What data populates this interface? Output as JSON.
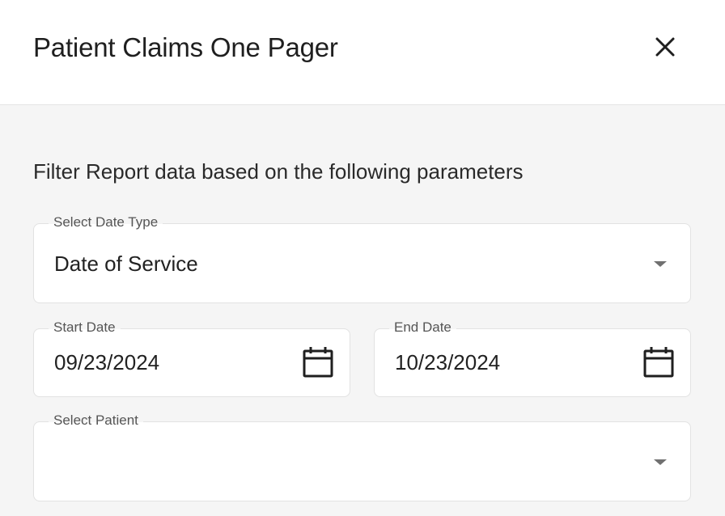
{
  "header": {
    "title": "Patient Claims One Pager",
    "close_icon": "close-icon"
  },
  "filter": {
    "subtitle": "Filter Report data based on the following parameters",
    "date_type": {
      "label": "Select Date Type",
      "value": "Date of Service",
      "icon": "chevron-down-icon"
    },
    "start_date": {
      "label": "Start Date",
      "value": "09/23/2024",
      "icon": "calendar-icon"
    },
    "end_date": {
      "label": "End Date",
      "value": "10/23/2024",
      "icon": "calendar-icon"
    },
    "patient": {
      "label": "Select Patient",
      "value": "",
      "icon": "chevron-down-icon"
    }
  },
  "colors": {
    "background": "#f5f5f5",
    "panel": "#ffffff",
    "border": "#e2e2e2",
    "text": "#1f1f1f",
    "label": "#555555",
    "caret": "#707070"
  }
}
